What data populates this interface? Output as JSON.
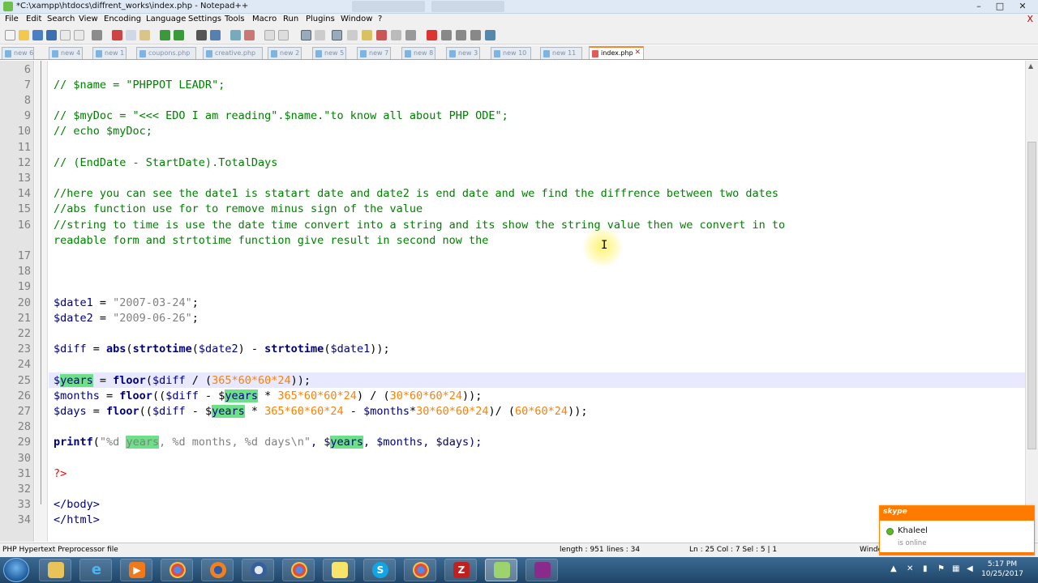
{
  "window": {
    "title": "*C:\\xampp\\htdocs\\diffrent_works\\index.php - Notepad++",
    "minimize_glyph": "–",
    "maximize_glyph": "□",
    "close_glyph": "✕"
  },
  "menu": [
    "File",
    "Edit",
    "Search",
    "View",
    "Encoding",
    "Language",
    "Settings",
    "Tools",
    "Macro",
    "Run",
    "Plugins",
    "Window",
    "?"
  ],
  "menu_close": "X",
  "tabs": [
    {
      "label": "new 6"
    },
    {
      "label": "new 4"
    },
    {
      "label": "new 1"
    },
    {
      "label": "coupons.php"
    },
    {
      "label": "creative.php"
    },
    {
      "label": "new 2"
    },
    {
      "label": "new 5"
    },
    {
      "label": "new 7"
    },
    {
      "label": "new 8"
    },
    {
      "label": "new 3"
    },
    {
      "label": "new 10"
    },
    {
      "label": "new 11"
    },
    {
      "label": "index.php",
      "active": true
    }
  ],
  "editor": {
    "line_numbers": [
      "6",
      "7",
      "8",
      "9",
      "10",
      "11",
      "12",
      "13",
      "14",
      "15",
      "16",
      "17",
      "18",
      "19",
      "20",
      "21",
      "22",
      "23",
      "24",
      "25",
      "26",
      "27",
      "28",
      "29",
      "30",
      "31",
      "32",
      "33",
      "34"
    ],
    "lines": {
      "l7": "// $name = \"PHPPOT LEADR\";",
      "l9": "// $myDoc = \"<<< EDO I am reading\".$name.\"to know all about PHP ODE\";",
      "l10": "// echo $myDoc;",
      "l12": "// (EndDate - StartDate).TotalDays",
      "l14": "//here you can see the date1 is statart date and date2 is end date and we find the diffrence between two dates",
      "l15": "//abs function use for to remove minus sign of the value",
      "l16a": "//string to time is use the date time convert into a string and its show the string value then we convert in to",
      "l16b": "readable form and strtotime function give result in second now the",
      "l20_var": "$date1",
      "l20_eq": " = ",
      "l20_str": "\"2007-03-24\"",
      "l20_end": ";",
      "l21_var": "$date2",
      "l21_eq": " = ",
      "l21_str": "\"2009-06-26\"",
      "l21_end": ";",
      "l23_var": "$diff",
      "l23_eq": " = ",
      "l23_abs": "abs",
      "l23_p1": "(",
      "l23_fn": "strtotime",
      "l23_p2": "(",
      "l23_a1": "$date2",
      "l23_p3": ") - ",
      "l23_fn2": "strtotime",
      "l23_p4": "(",
      "l23_a2": "$date1",
      "l23_p5": "));",
      "l25_dollar": "$",
      "l25_hl": "years",
      "l25_eq": " = ",
      "l25_fn": "floor",
      "l25_p1": "(",
      "l25_v": "$diff",
      "l25_op": " / (",
      "l25_num": "365*60*60*24",
      "l25_end": "));",
      "l26_var": "$months",
      "l26_eq": " = ",
      "l26_fn": "floor",
      "l26_p1": "((",
      "l26_v": "$diff",
      "l26_op": " - $",
      "l26_hl": "years",
      "l26_op2": " * ",
      "l26_num": "365*60*60*24",
      "l26_p2": ") / (",
      "l26_num2": "30*60*60*24",
      "l26_end": "));",
      "l27_var": "$days",
      "l27_eq": " = ",
      "l27_fn": "floor",
      "l27_p1": "((",
      "l27_v": "$diff",
      "l27_op": " - $",
      "l27_hl": "years",
      "l27_op2": " * ",
      "l27_num": "365*60*60*24",
      "l27_op3": " - ",
      "l27_v2": "$months",
      "l27_op4": "*",
      "l27_num2": "30*60*60*24",
      "l27_p2": ")/ (",
      "l27_num3": "60*60*24",
      "l27_end": "));",
      "l29_fn": "printf",
      "l29_p1": "(",
      "l29_s1": "\"%d ",
      "l29_hl": "years",
      "l29_s2": ", %d months, %d days\\n\"",
      "l29_c": ", $",
      "l29_hl2": "years",
      "l29_rest": ", $months, $days);",
      "l31": "?>",
      "l33": "</body>",
      "l34": "</html>"
    }
  },
  "statusbar": {
    "file_type": "PHP Hypertext Preprocessor file",
    "length": "length : 951",
    "lines": "lines : 34",
    "position": "Ln : 25    Col : 7    Sel : 5 | 1",
    "eol": "Windo"
  },
  "skype_popup": {
    "logo": "skype",
    "contact": "Khaleel",
    "status": "is online"
  },
  "taskbar": {
    "apps": [
      "file-explorer",
      "internet-explorer",
      "media-player",
      "chrome",
      "firefox",
      "thunderbird",
      "chrome",
      "sticky-notes",
      "skype",
      "chrome",
      "filezilla",
      "notepad-plus-plus",
      "remote-app"
    ],
    "clock_time": "5:17 PM",
    "clock_date": "10/25/2017"
  },
  "colors": {
    "comment": "#008000",
    "keyword_fn": "#000080",
    "string": "#808080",
    "number": "#ff8000",
    "highlight": "#6fe08a",
    "skype_orange": "#ff7a00"
  }
}
